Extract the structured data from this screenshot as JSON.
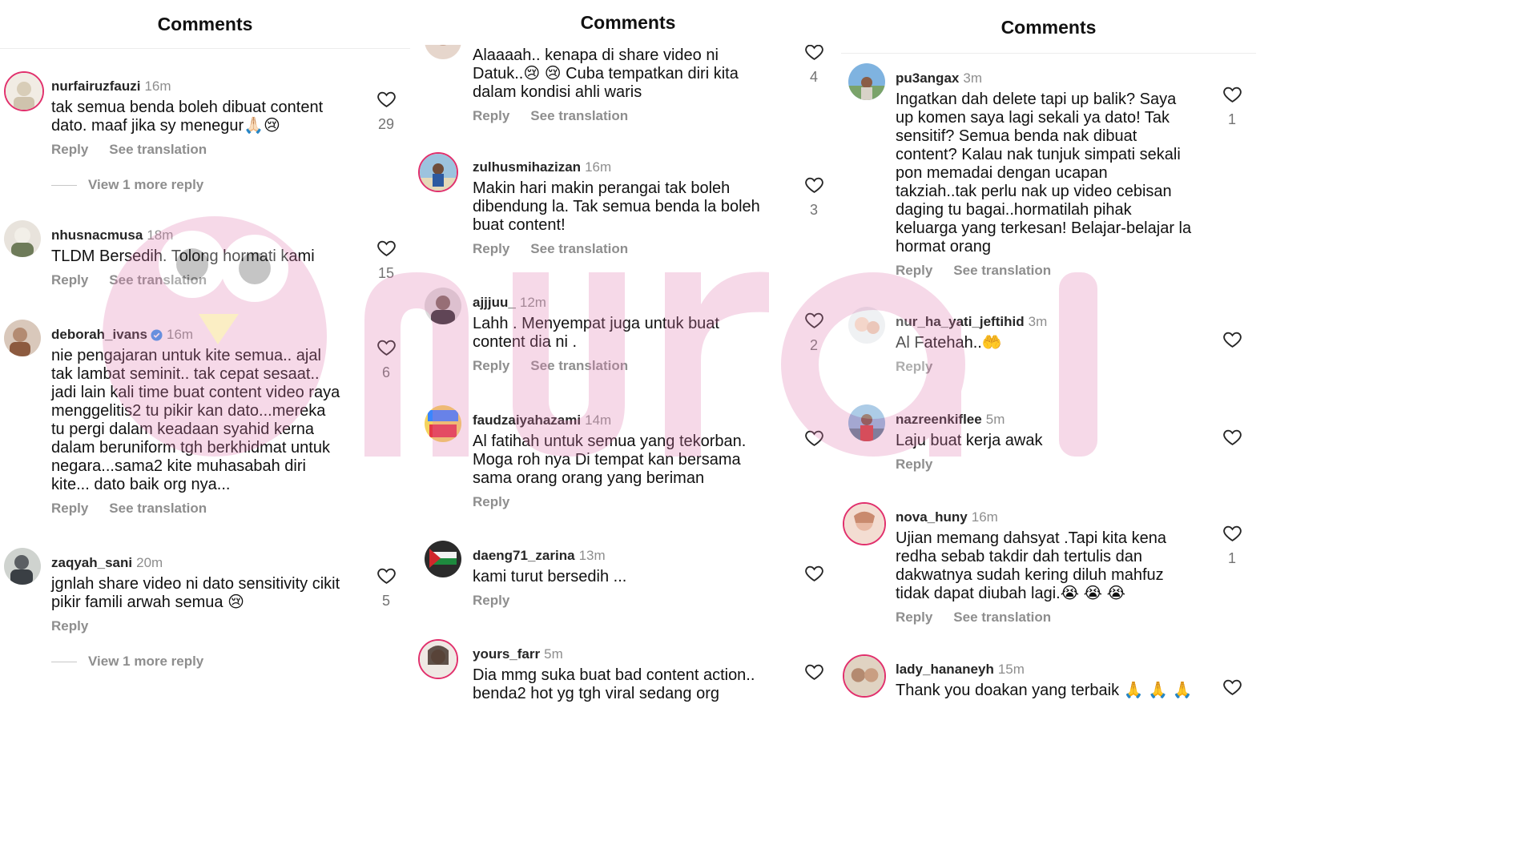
{
  "panels": [
    {
      "title": "Comments",
      "comments": [
        {
          "username": "nurfairuzfauzi",
          "time": "16m",
          "verified": false,
          "text": "tak semua benda boleh dibuat content\ndato. maaf jika sy menegur🙏🏻😢",
          "likes": "29",
          "actions": [
            "Reply",
            "See translation"
          ],
          "more": "View 1 more reply"
        },
        {
          "username": "nhusnacmusa",
          "time": "18m",
          "verified": false,
          "text": "TLDM Bersedih. Tolong hormati kami",
          "likes": "15",
          "actions": [
            "Reply",
            "See translation"
          ],
          "more": ""
        },
        {
          "username": "deborah_ivans",
          "time": "16m",
          "verified": true,
          "text": "nie pengajaran untuk kite semua.. ajal\ntak lambat seminit.. tak cepat sesaat..\njadi lain kali time buat content video raya\nmenggelitis2 tu pikir kan dato...mereka\ntu pergi dalam keadaan syahid kerna\ndalam beruniform tgh berkhidmat untuk\nnegara...sama2 kite muhasabah diri\nkite... dato baik  org nya...",
          "likes": "6",
          "actions": [
            "Reply",
            "See translation"
          ],
          "more": ""
        },
        {
          "username": "zaqyah_sani",
          "time": "20m",
          "verified": false,
          "text": "jgnlah share video ni dato sensitivity cikit\npikir famili arwah semua 😢",
          "likes": "5",
          "actions": [
            "Reply"
          ],
          "more": "View 1 more reply"
        }
      ]
    },
    {
      "title": "Comments",
      "comments": [
        {
          "username": "",
          "time": "",
          "verified": false,
          "text": "Alaaaah.. kenapa di share video ni\nDatuk..😢 😢 Cuba tempatkan diri kita\ndalam kondisi ahli waris",
          "likes": "4",
          "actions": [
            "Reply",
            "See translation"
          ],
          "more": ""
        },
        {
          "username": "zulhusmihazizan",
          "time": "16m",
          "verified": false,
          "text": "Makin hari makin perangai tak boleh\ndibendung la. Tak semua benda la boleh\nbuat content!",
          "likes": "3",
          "actions": [
            "Reply",
            "See translation"
          ],
          "more": ""
        },
        {
          "username": "ajjjuu_",
          "time": "12m",
          "verified": false,
          "text": "Lahh . Menyempat juga untuk buat\ncontent dia ni .",
          "likes": "2",
          "actions": [
            "Reply",
            "See translation"
          ],
          "more": ""
        },
        {
          "username": "faudzaiyahazami",
          "time": "14m",
          "verified": false,
          "text": "Al fatihah untuk semua yang tekorban.\nMoga roh nya Di tempat kan bersama\nsama orang orang yang beriman",
          "likes": "",
          "actions": [
            "Reply"
          ],
          "more": ""
        },
        {
          "username": "daeng71_zarina",
          "time": "13m",
          "verified": false,
          "text": "kami turut bersedih ...",
          "likes": "",
          "actions": [
            "Reply"
          ],
          "more": ""
        },
        {
          "username": "yours_farr",
          "time": "5m",
          "verified": false,
          "text": "Dia mmg suka buat bad content action..\nbenda2 hot yg tgh viral sedang org",
          "likes": "",
          "actions": [],
          "more": ""
        }
      ]
    },
    {
      "title": "Comments",
      "comments": [
        {
          "username": "pu3angax",
          "time": "3m",
          "verified": false,
          "text": "Ingatkan dah delete tapi up balik? Saya\nup komen saya lagi sekali ya dato!  Tak\nsensitif? Semua benda nak dibuat\ncontent? Kalau nak tunjuk simpati sekali\npon memadai dengan ucapan\ntakziah..tak perlu nak up video cebisan\ndaging tu bagai..hormatilah pihak\nkeluarga yang terkesan! Belajar-belajar la\nhormat orang",
          "likes": "1",
          "actions": [
            "Reply",
            "See translation"
          ],
          "more": ""
        },
        {
          "username": "nur_ha_yati_jeftihid",
          "time": "3m",
          "verified": false,
          "text": "Al Fatehah..🤲",
          "likes": "",
          "actions": [
            "Reply"
          ],
          "more": ""
        },
        {
          "username": "nazreenkiflee",
          "time": "5m",
          "verified": false,
          "text": "Laju buat kerja awak",
          "likes": "",
          "actions": [
            "Reply"
          ],
          "more": ""
        },
        {
          "username": "nova_huny",
          "time": "16m",
          "verified": false,
          "text": "Ujian memang dahsyat .Tapi kita kena\nredha sebab takdir  dah tertulis dan\ndakwatnya sudah kering  diluh mahfuz\ntidak dapat diubah lagi.😭 😭 😭",
          "likes": "1",
          "actions": [
            "Reply",
            "See translation"
          ],
          "more": ""
        },
        {
          "username": "lady_hananeyh",
          "time": "15m",
          "verified": false,
          "text": "Thank you doakan yang terbaik 🙏 🙏 🙏",
          "likes": "",
          "actions": [],
          "more": ""
        }
      ]
    }
  ],
  "watermark": "nurai",
  "colors": {
    "story_ring": "#e1306c",
    "verified": "#3897f0",
    "muted": "#8e8e8e",
    "watermark": "#e07bb0"
  }
}
